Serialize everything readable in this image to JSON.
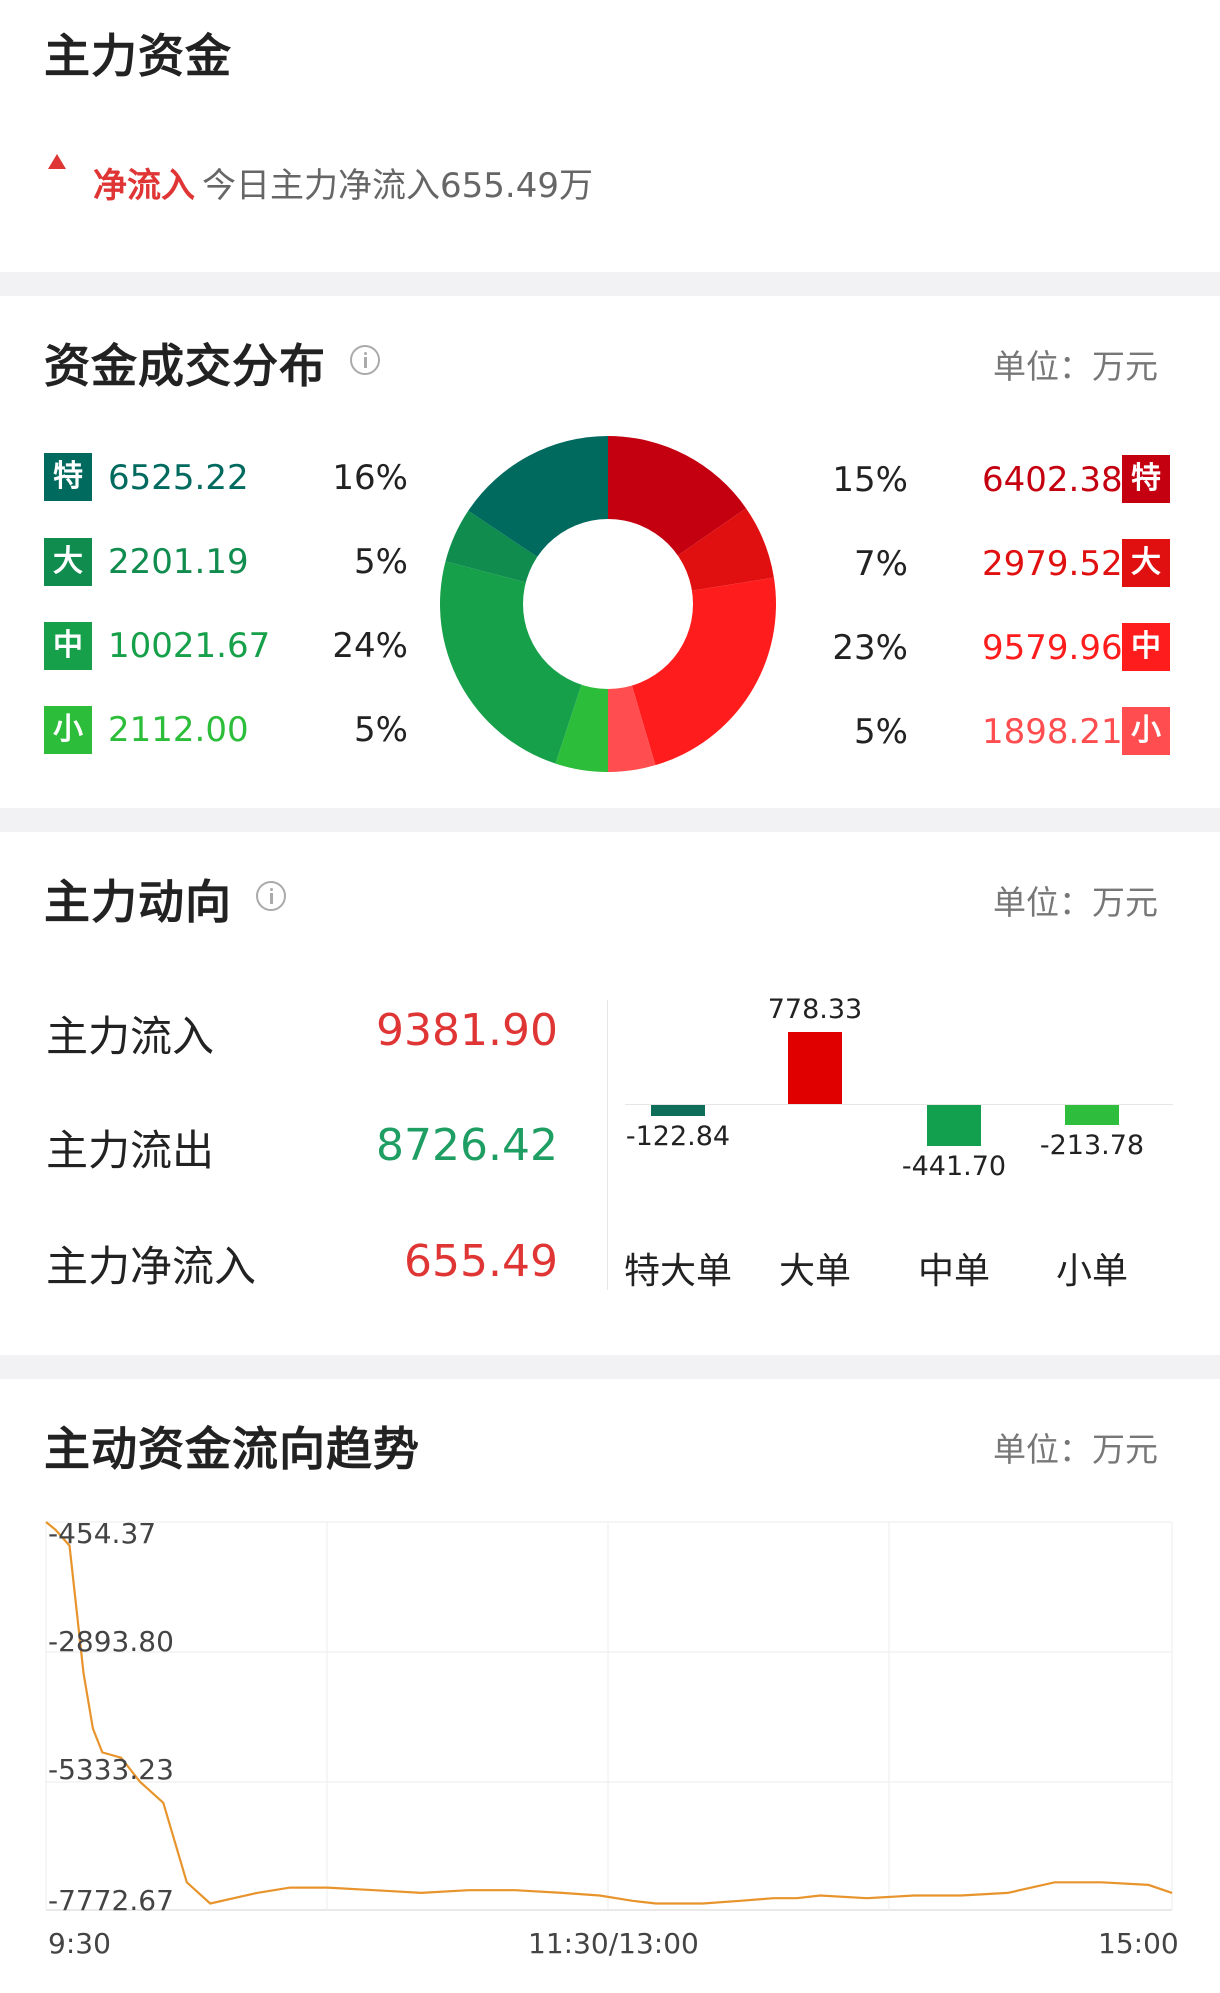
{
  "header": {
    "title": "主力资金",
    "net_flow_tag": "净流入",
    "net_flow_text": "今日主力净流入655.49万"
  },
  "distribution": {
    "title": "资金成交分布",
    "unit": "单位：万元",
    "outflow": [
      {
        "badge": "特",
        "value": "6525.22",
        "pct": "16%",
        "color": "#006a5e"
      },
      {
        "badge": "大",
        "value": "2201.19",
        "pct": "5%",
        "color": "#0f8c4e"
      },
      {
        "badge": "中",
        "value": "10021.67",
        "pct": "24%",
        "color": "#17a04a"
      },
      {
        "badge": "小",
        "value": "2112.00",
        "pct": "5%",
        "color": "#2cbd3a"
      }
    ],
    "inflow": [
      {
        "badge": "特",
        "value": "6402.38",
        "pct": "15%",
        "color": "#c40010"
      },
      {
        "badge": "大",
        "value": "2979.52",
        "pct": "7%",
        "color": "#e01010"
      },
      {
        "badge": "中",
        "value": "9579.96",
        "pct": "23%",
        "color": "#ff1c1c"
      },
      {
        "badge": "小",
        "value": "1898.21",
        "pct": "5%",
        "color": "#ff4d50"
      }
    ]
  },
  "main_flow": {
    "title": "主力动向",
    "unit": "单位：万元",
    "rows": [
      {
        "label": "主力流入",
        "value": "9381.90",
        "color": "#e03535"
      },
      {
        "label": "主力流出",
        "value": "8726.42",
        "color": "#1e9e62"
      },
      {
        "label": "主力净流入",
        "value": "655.49",
        "color": "#e03535"
      }
    ],
    "bars": [
      {
        "label": "特大单",
        "value": -122.84,
        "text": "-122.84",
        "color": "#0e6e5a"
      },
      {
        "label": "大单",
        "value": 778.33,
        "text": "778.33",
        "color": "#e00000"
      },
      {
        "label": "中单",
        "value": -441.7,
        "text": "-441.70",
        "color": "#12a04e"
      },
      {
        "label": "小单",
        "value": -213.78,
        "text": "-213.78",
        "color": "#2ebd3c"
      }
    ]
  },
  "trend": {
    "title": "主动资金流向趋势",
    "unit": "单位：万元",
    "y_ticks": [
      "-454.37",
      "-2893.80",
      "-5333.23",
      "-7772.67"
    ],
    "x_ticks": [
      "9:30",
      "11:30/13:00",
      "15:00"
    ],
    "line_color": "#e8942c"
  },
  "chart_data": {
    "type": "line",
    "title": "主动资金流向趋势",
    "ylim": [
      -7772.67,
      -454.37
    ],
    "x_labels": [
      "9:30",
      "11:30/13:00",
      "15:00"
    ],
    "x": [
      0,
      2,
      5,
      8,
      10,
      12,
      16,
      20,
      25,
      30,
      35,
      40,
      45,
      52,
      60,
      70,
      80,
      90,
      100,
      110,
      118,
      125,
      130,
      135,
      140,
      148,
      155,
      160,
      165,
      175,
      185,
      195,
      205,
      215,
      225,
      235,
      240
    ],
    "y": [
      -454,
      -600,
      -900,
      -3300,
      -4350,
      -4800,
      -4900,
      -5350,
      -5750,
      -7250,
      -7650,
      -7550,
      -7450,
      -7350,
      -7350,
      -7400,
      -7450,
      -7400,
      -7400,
      -7450,
      -7500,
      -7600,
      -7650,
      -7650,
      -7650,
      -7600,
      -7550,
      -7550,
      -7500,
      -7550,
      -7500,
      -7500,
      -7450,
      -7250,
      -7250,
      -7300,
      -7450
    ],
    "grid": true
  }
}
